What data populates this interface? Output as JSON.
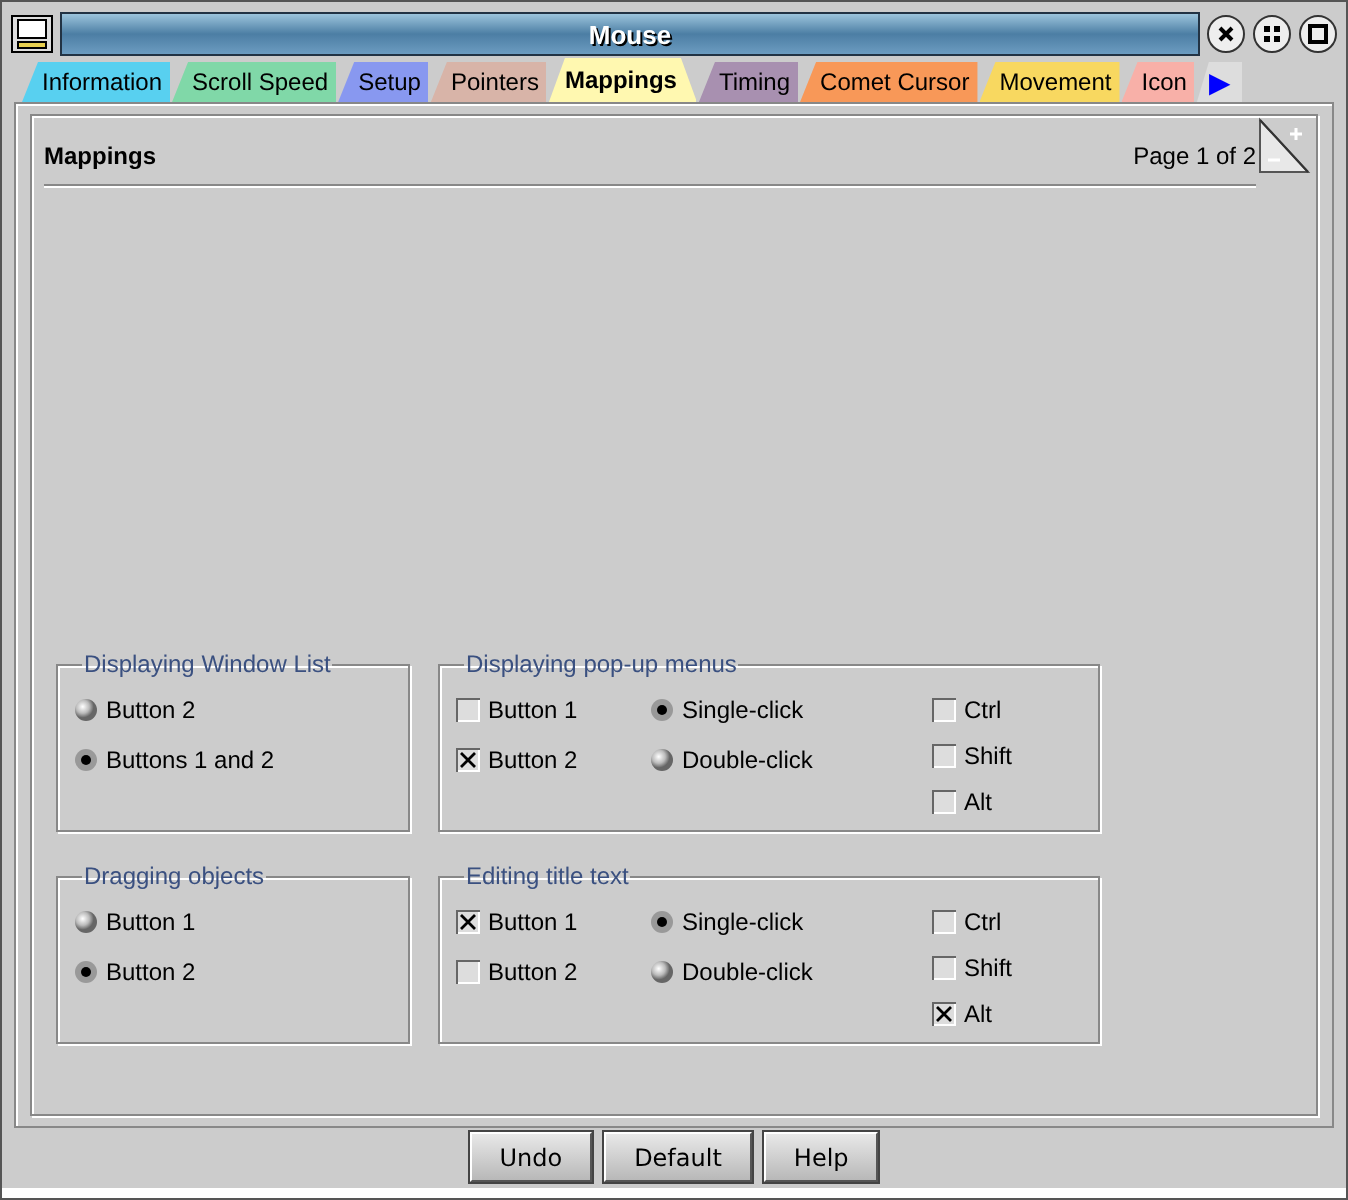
{
  "window": {
    "title": "Mouse"
  },
  "tabs": [
    {
      "label": "Information",
      "color": "#58d0f0",
      "selected": false
    },
    {
      "label": "Scroll Speed",
      "color": "#80d8a8",
      "selected": false
    },
    {
      "label": "Setup",
      "color": "#8898f0",
      "selected": false
    },
    {
      "label": "Pointers",
      "color": "#d8b4a8",
      "selected": false
    },
    {
      "label": "Mappings",
      "color": "#fff8b0",
      "selected": true
    },
    {
      "label": "Timing",
      "color": "#a890b0",
      "selected": false
    },
    {
      "label": "Comet Cursor",
      "color": "#f89858",
      "selected": false
    },
    {
      "label": "Movement",
      "color": "#f8d860",
      "selected": false
    },
    {
      "label": "Icon",
      "color": "#f8b0a8",
      "selected": false
    }
  ],
  "tab_scroll": "▶",
  "page": {
    "title": "Mappings",
    "page_number": "Page 1 of 2"
  },
  "groups": [
    {
      "kind": "radio",
      "title": "Displaying Window List",
      "options": [
        {
          "label": "Button 2",
          "selected": false
        },
        {
          "label": "Buttons 1 and 2",
          "selected": true
        }
      ]
    },
    {
      "kind": "combo",
      "title": "Displaying pop-up menus",
      "buttons": [
        {
          "label": "Button 1",
          "checked": false
        },
        {
          "label": "Button 2",
          "checked": true
        }
      ],
      "clicks": [
        {
          "label": "Single-click",
          "selected": true
        },
        {
          "label": "Double-click",
          "selected": false
        }
      ],
      "modifiers": [
        {
          "label": "Ctrl",
          "checked": false
        },
        {
          "label": "Shift",
          "checked": false
        },
        {
          "label": "Alt",
          "checked": false
        }
      ]
    },
    {
      "kind": "radio",
      "title": "Dragging objects",
      "options": [
        {
          "label": "Button 1",
          "selected": false
        },
        {
          "label": "Button 2",
          "selected": true
        }
      ]
    },
    {
      "kind": "combo",
      "title": "Editing title text",
      "buttons": [
        {
          "label": "Button 1",
          "checked": true
        },
        {
          "label": "Button 2",
          "checked": false
        }
      ],
      "clicks": [
        {
          "label": "Single-click",
          "selected": true
        },
        {
          "label": "Double-click",
          "selected": false
        }
      ],
      "modifiers": [
        {
          "label": "Ctrl",
          "checked": false
        },
        {
          "label": "Shift",
          "checked": false
        },
        {
          "label": "Alt",
          "checked": true
        }
      ]
    }
  ],
  "buttons": [
    "Undo",
    "Default",
    "Help"
  ]
}
